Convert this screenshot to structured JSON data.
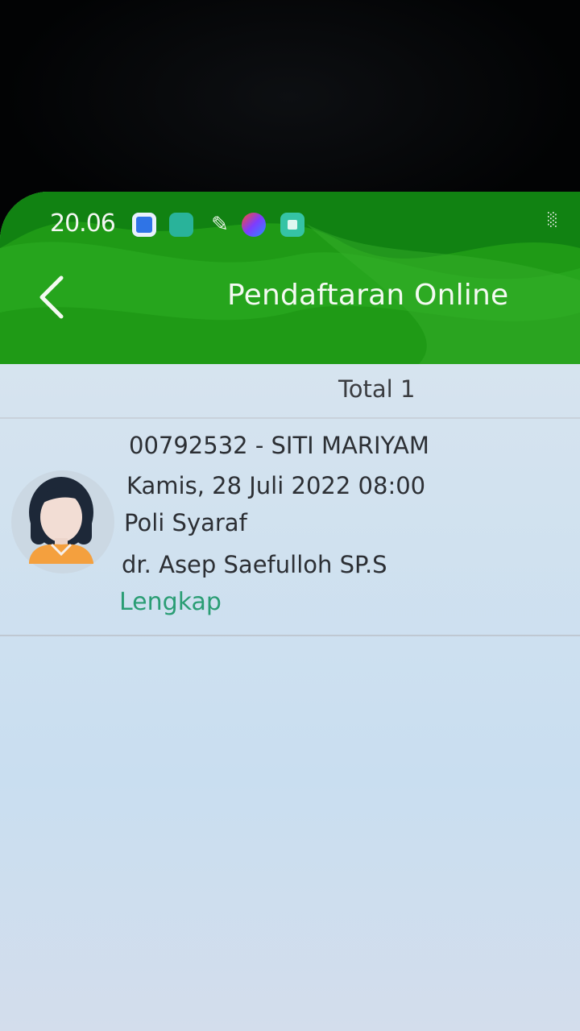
{
  "status_bar": {
    "time": "20.06",
    "signal": "░"
  },
  "header": {
    "title": "Pendaftaran Online",
    "back_icon": "chevron-left-icon"
  },
  "list": {
    "total_label": "Total 1",
    "items": [
      {
        "id_name": "00792532 - SITI MARIYAM",
        "datetime": "Kamis, 28 Juli 2022 08:00",
        "clinic": "Poli Syaraf",
        "doctor": "dr. Asep Saefulloh SP.S",
        "status": "Lengkap",
        "avatar_icon": "woman-avatar-icon"
      }
    ]
  },
  "colors": {
    "header_green": "#1f9a16",
    "status_green": "#2a9d74",
    "background": "#d2e2ef"
  }
}
